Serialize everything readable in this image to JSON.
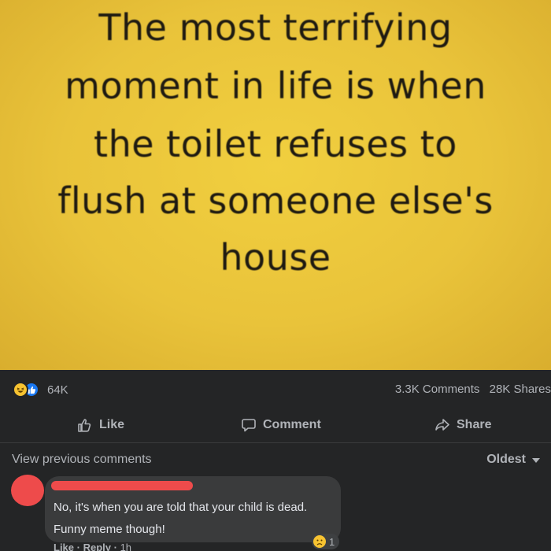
{
  "meme": {
    "lines": [
      "The most terrifying",
      "moment in life is when",
      "the toilet refuses to",
      "flush at someone else's",
      "house"
    ]
  },
  "stats": {
    "reaction_count": "64K",
    "comments_count": "3.3K Comments",
    "shares_count": "28K Shares",
    "reaction_icons": [
      "haha-icon",
      "like-icon"
    ]
  },
  "actions": {
    "like_label": "Like",
    "comment_label": "Comment",
    "share_label": "Share"
  },
  "comments": {
    "view_previous": "View previous comments",
    "sort_label": "Oldest",
    "items": [
      {
        "text_line1": "No, it's when you are told that your child is dead.",
        "text_line2": "Funny meme though!",
        "like": "Like",
        "reply": "Reply",
        "time": "1h",
        "reaction_count": "1",
        "reaction_icon": "sad-icon"
      }
    ]
  },
  "colors": {
    "background": "#18191a",
    "panel": "#242526",
    "bubble": "#3a3b3c",
    "meme_yellow": "#e9c33a",
    "redaction": "#ee4b4b",
    "like_blue": "#1877f2"
  }
}
